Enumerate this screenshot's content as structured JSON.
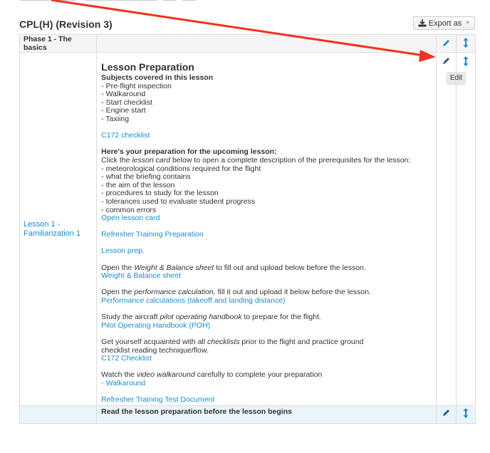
{
  "page": {
    "title": "CPL(H) (Revision 3)",
    "export_label": "Export as",
    "export_icon": "download-icon",
    "tooltip": "Edit"
  },
  "phase": {
    "name": "Phase 1 - The basics",
    "edit_icon": "pencil-icon",
    "move_icon": "vertical-arrows-icon"
  },
  "lesson": {
    "name": "Lesson 1 - Familiarization 1",
    "heading": "Lesson Preparation",
    "subjects_title": "Subjects covered in this lesson",
    "subjects": [
      "- Pre-flight inspection",
      "- Walkaround",
      "- Start checklist",
      "- Engine start",
      "- Taxiing"
    ],
    "checklist_link": "C172 checklist",
    "prep_title": "Here's your preparation for the upcoming lesson:",
    "prep_intro_a": "Click the ",
    "prep_intro_em": "lesson card",
    "prep_intro_b": " below to open a complete description of the prerequisites for the lesson:",
    "prep_items": [
      "- meteorological conditions required for the flight",
      "- what the briefing contains",
      "- the aim of the lesson",
      "- procedures to study for the lesson",
      "- tolerances used to evaluate student progress",
      "- common errors"
    ],
    "open_card_link": "Open lesson card",
    "refresher_link": "Refresher Training Preparation",
    "lesson_prep_link": "Lesson prep.",
    "wb_a": "Open the ",
    "wb_em": "Weight & Balance sheet",
    "wb_b": " to fill out and upload below before the lesson.",
    "wb_link": "Weight & Balance sheet",
    "perf_a": "Open the ",
    "perf_em": "performance calculation,",
    "perf_b": " fill it out and upload it below before the lesson.",
    "perf_link": "Performance calculations (takeoff and landing distance)",
    "poh_a": "Study the aircraft ",
    "poh_em": "pilot operating handbook",
    "poh_b": " to prepare for the flight.",
    "poh_link": "Pilot Operating Handbook (POH)",
    "cl_a": "Get yourself acquainted with all ",
    "cl_em": "checklists",
    "cl_b": " prior to the flight and practice ground checklist reading technique/flow.",
    "cl_link": "C172 Checklist",
    "vid_a": "Watch the ",
    "vid_em": "video walkaround",
    "vid_b": " carefully to complete your preparation",
    "vid_link": "- Walkaround",
    "test_link": "Refresher Training Test Document"
  },
  "next_row": {
    "text": "Read the lesson preparation before the lesson begins"
  },
  "colors": {
    "link": "#1a8ccf",
    "annotation_arrow": "#f0321e",
    "next_row_bg": "#eaf4fb"
  }
}
